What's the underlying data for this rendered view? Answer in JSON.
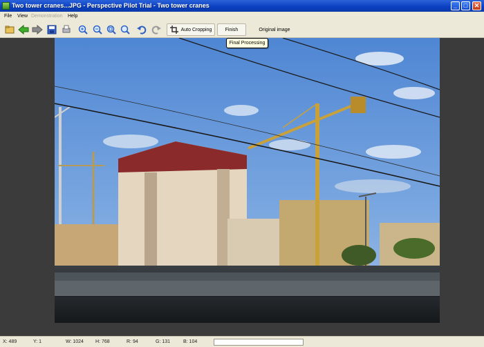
{
  "window": {
    "title": "Two tower cranes...JPG - Perspective Pilot Trial - Two tower cranes"
  },
  "titlebar": {
    "minimize": "_",
    "maximize": "□",
    "close": "✕"
  },
  "menu": {
    "file": "File",
    "view": "View",
    "demonstration": "Demonstration",
    "help": "Help"
  },
  "toolbar": {
    "auto_cropping": "Auto Cropping",
    "finish": "Finish",
    "original_image": "Original image",
    "tooltip": "Final Processing",
    "icons": [
      "open-icon",
      "back-arrow-icon",
      "forward-arrow-icon",
      "save-icon",
      "print-icon",
      "zoom-in-icon",
      "zoom-out-icon",
      "zoom-fit-icon",
      "zoom-actual-icon",
      "undo-icon",
      "redo-icon",
      "crop-icon"
    ]
  },
  "statusbar": {
    "x": "X: 489",
    "y": "Y: 1",
    "w": "W: 1024",
    "h": "H: 768",
    "r": "R: 94",
    "g": "G: 131",
    "b": "B: 104"
  },
  "colors": {
    "titlebar": "#0a3fc0",
    "workarea": "#3b3b3b",
    "sky": "#5a8fd6",
    "crane": "#c9a13a"
  }
}
